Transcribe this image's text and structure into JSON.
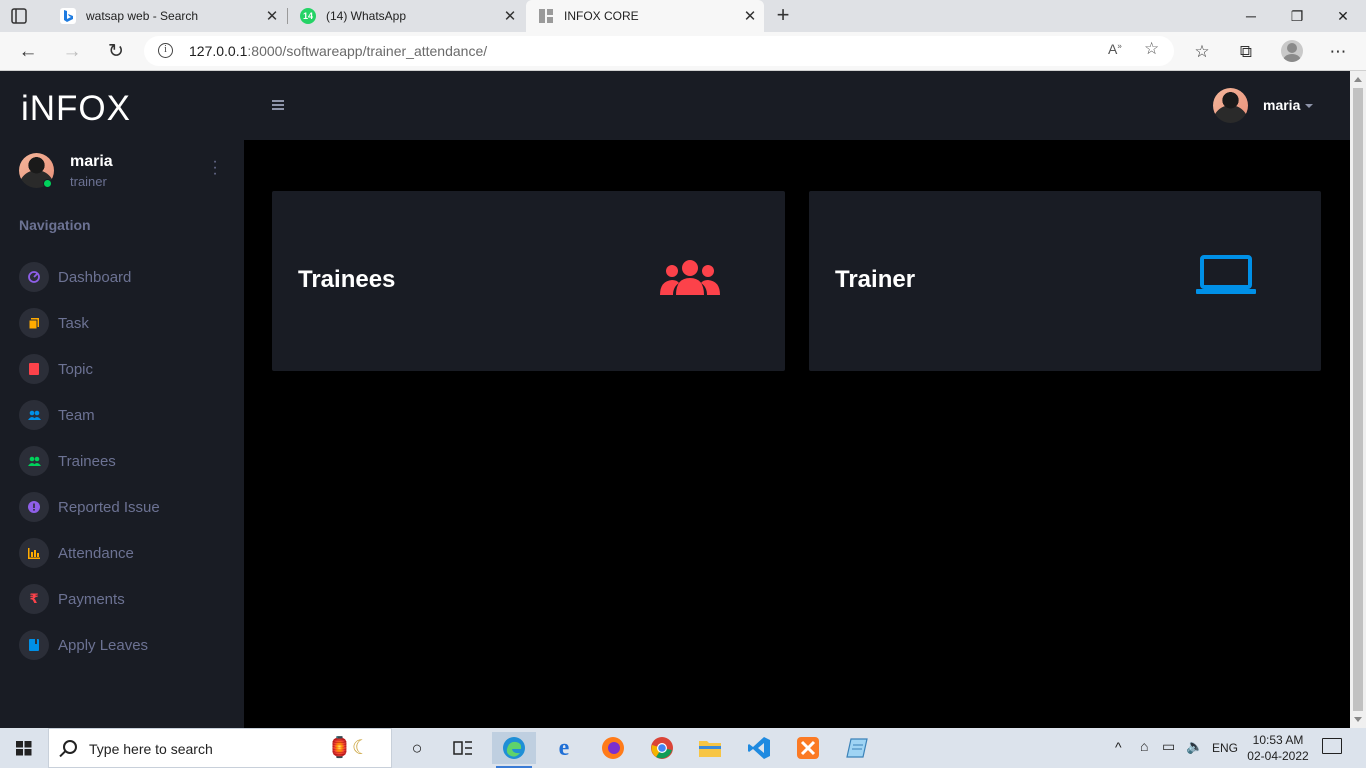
{
  "browser": {
    "tabs": [
      {
        "title": "watsap web - Search",
        "icon": "bing-icon",
        "active": false
      },
      {
        "title": "(14) WhatsApp",
        "icon": "whatsapp-icon",
        "badge": "14",
        "active": false
      },
      {
        "title": "INFOX CORE",
        "icon": "page-icon",
        "active": true
      }
    ],
    "url_host": "127.0.0.1",
    "url_rest": ":8000/softwareapp/trainer_attendance/"
  },
  "app": {
    "logo": "iNFOX",
    "user": {
      "name": "maria",
      "role": "trainer"
    },
    "nav_heading": "Navigation",
    "nav": [
      {
        "label": "Dashboard",
        "icon": "speedometer-icon",
        "color": "#8f5fe8"
      },
      {
        "label": "Task",
        "icon": "task-icon",
        "color": "#ffab00"
      },
      {
        "label": "Topic",
        "icon": "book-icon",
        "color": "#fc424a"
      },
      {
        "label": "Team",
        "icon": "team-icon",
        "color": "#0090e7"
      },
      {
        "label": "Trainees",
        "icon": "trainees-icon",
        "color": "#00d25b"
      },
      {
        "label": "Reported Issue",
        "icon": "alert-icon",
        "color": "#8f5fe8"
      },
      {
        "label": "Attendance",
        "icon": "chart-bar-icon",
        "color": "#ffab00"
      },
      {
        "label": "Payments",
        "icon": "rupee-icon",
        "color": "#fc424a"
      },
      {
        "label": "Apply Leaves",
        "icon": "calendar-icon",
        "color": "#0090e7"
      }
    ],
    "topbar_user": "maria",
    "cards": [
      {
        "title": "Trainees",
        "icon": "people-group-icon",
        "icon_color": "#fc424a"
      },
      {
        "title": "Trainer",
        "icon": "laptop-icon",
        "icon_color": "#0090e7"
      }
    ]
  },
  "taskbar": {
    "search_placeholder": "Type here to search",
    "lang": "ENG",
    "time": "10:53 AM",
    "date": "02-04-2022"
  }
}
